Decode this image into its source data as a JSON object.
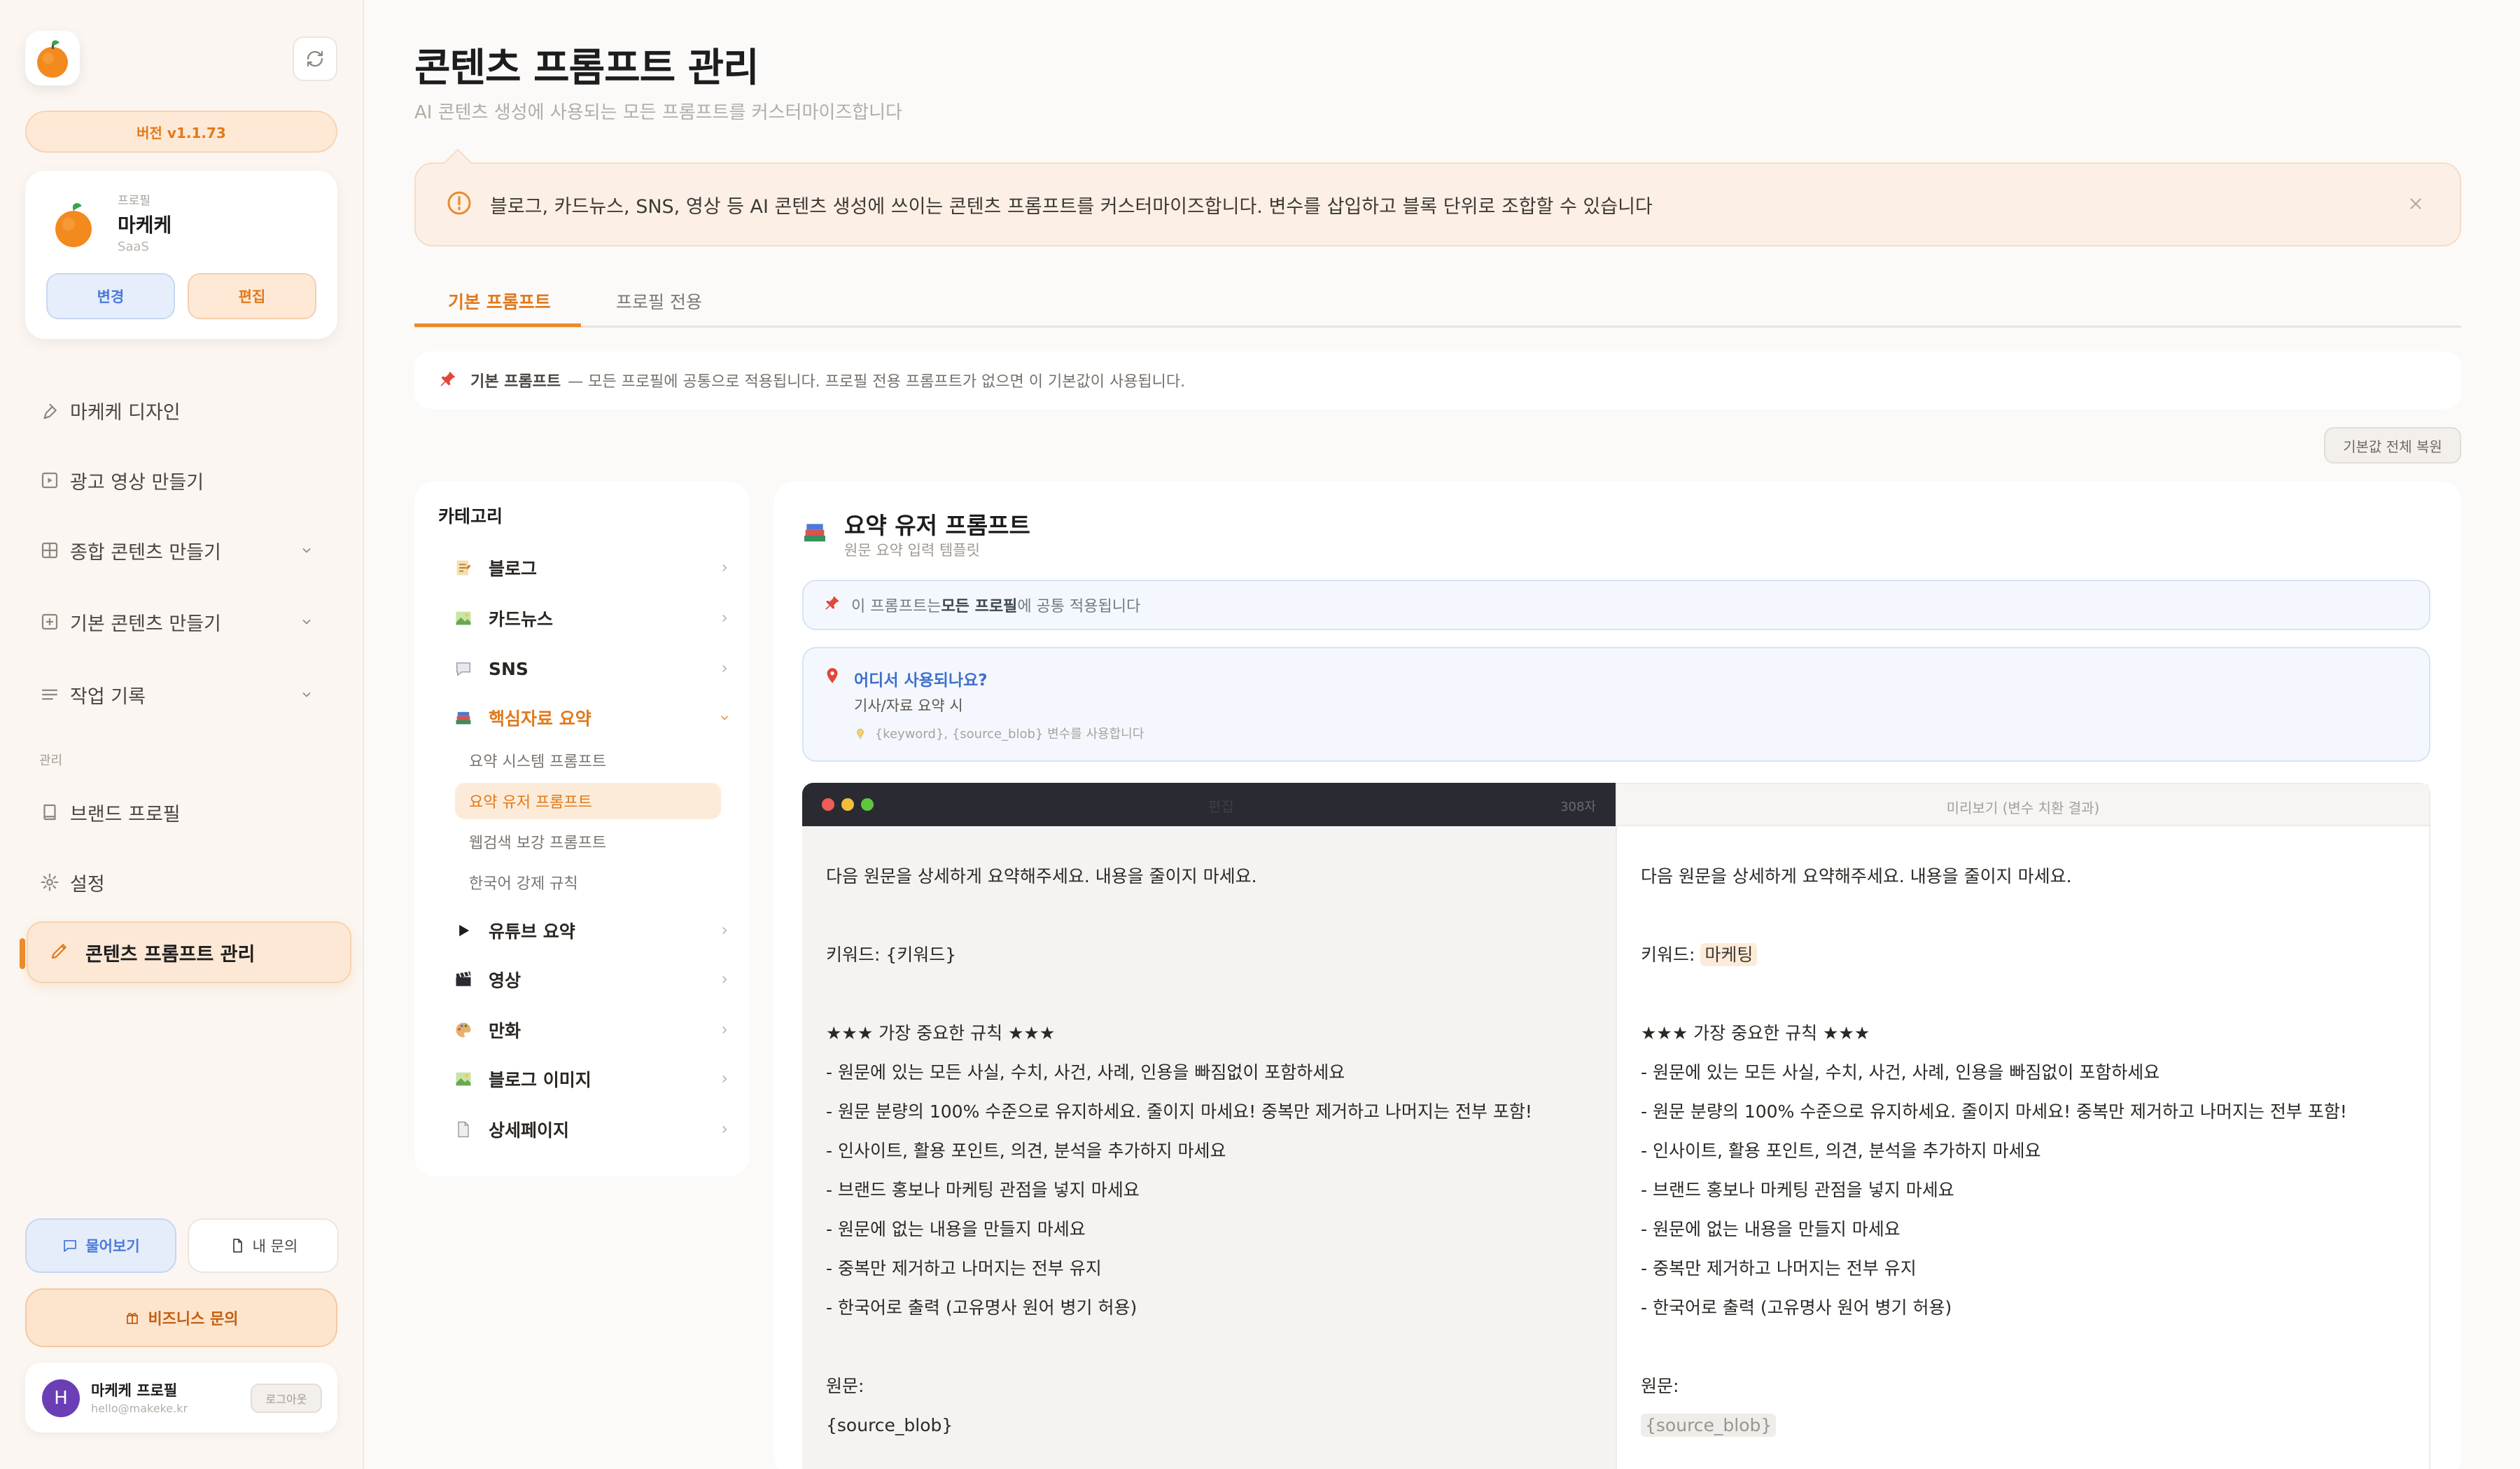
{
  "sidebar": {
    "version": "버전 v1.1.73",
    "profile": {
      "label": "프로필",
      "name": "마케케",
      "type": "SaaS",
      "change_label": "변경",
      "edit_label": "편집"
    },
    "nav": [
      {
        "label": "마케케 디자인"
      },
      {
        "label": "광고 영상 만들기"
      },
      {
        "label": "종합 콘텐츠 만들기"
      },
      {
        "label": "기본 콘텐츠 만들기"
      },
      {
        "label": "작업 기록"
      }
    ],
    "section_manage": "관리",
    "nav_manage": [
      {
        "label": "브랜드 프로필"
      },
      {
        "label": "설정"
      },
      {
        "label": "콘텐츠 프롬프트 관리"
      }
    ],
    "help_ask": "물어보기",
    "help_mine": "내 문의",
    "business": "비즈니스 문의",
    "user": {
      "initial": "H",
      "name": "마케케 프로필",
      "email": "hello@makeke.kr",
      "logout": "로그아웃"
    }
  },
  "header": {
    "title": "콘텐츠 프롬프트 관리",
    "subtitle": "AI 콘텐츠 생성에 사용되는 모든 프롬프트를 커스터마이즈합니다"
  },
  "banner": {
    "text": "블로그, 카드뉴스, SNS, 영상 등 AI 콘텐츠 생성에 쓰이는 콘텐츠 프롬프트를 커스터마이즈합니다. 변수를 삽입하고 블록 단위로 조합할 수 있습니다"
  },
  "tabs": [
    {
      "label": "기본 프롬프트"
    },
    {
      "label": "프로필 전용"
    }
  ],
  "tip": {
    "strong": "기본 프롬프트",
    "text": "— 모든 프로필에 공통으로 적용됩니다. 프로필 전용 프롬프트가 없으면 이 기본값이 사용됩니다."
  },
  "reset_all": "기본값 전체 복원",
  "categories": {
    "title": "카테고리",
    "items": [
      {
        "label": "블로그"
      },
      {
        "label": "카드뉴스"
      },
      {
        "label": "SNS"
      },
      {
        "label": "핵심자료 요약"
      },
      {
        "label": "유튜브 요약"
      },
      {
        "label": "영상"
      },
      {
        "label": "만화"
      },
      {
        "label": "블로그 이미지"
      },
      {
        "label": "상세페이지"
      }
    ],
    "sub_items": [
      {
        "label": "요약 시스템 프롬프트"
      },
      {
        "label": "요약 유저 프롬프트"
      },
      {
        "label": "웹검색 보강 프롬프트"
      },
      {
        "label": "한국어 강제 규칙"
      }
    ]
  },
  "prompt": {
    "title": "요약 유저 프롬프트",
    "subtitle": "원문 요약 입력 템플릿",
    "common_pre": "이 프롬프트는 ",
    "common_strong": "모든 프로필",
    "common_post": "에 공통 적용됩니다",
    "where_q": "어디서 사용되나요?",
    "where_a": "기사/자료 요약 시",
    "where_b": "{keyword}, {source_blob} 변수를 사용합니다",
    "editor_mode": "편집",
    "char_count": "308자",
    "preview_mode": "미리보기 (변수 치환 결과)",
    "editor_lines": [
      "다음 원문을 상세하게 요약해주세요. 내용을 줄이지 마세요.",
      "",
      "키워드: {키워드}",
      "",
      "★★★ 가장 중요한 규칙 ★★★",
      "- 원문에 있는 모든 사실, 수치, 사건, 사례, 인용을 빠짐없이 포함하세요",
      "- 원문 분량의 100% 수준으로 유지하세요. 줄이지 마세요! 중복만 제거하고 나머지는 전부 포함!",
      "- 인사이트, 활용 포인트, 의견, 분석을 추가하지 마세요",
      "- 브랜드 홍보나 마케팅 관점을 넣지 마세요",
      "- 원문에 없는 내용을 만들지 마세요",
      "- 중복만 제거하고 나머지는 전부 유지",
      "- 한국어로 출력 (고유명사 원어 병기 허용)",
      "",
      "원문:",
      "{source_blob}"
    ],
    "preview_keyword_label": "키워드: ",
    "preview_keyword_value": "마케팅",
    "preview_source_label": "원문:",
    "preview_source_value": "{source_blob}"
  },
  "colors": {
    "accent": "#ec8a2c",
    "blue": "#4b7ad8"
  }
}
